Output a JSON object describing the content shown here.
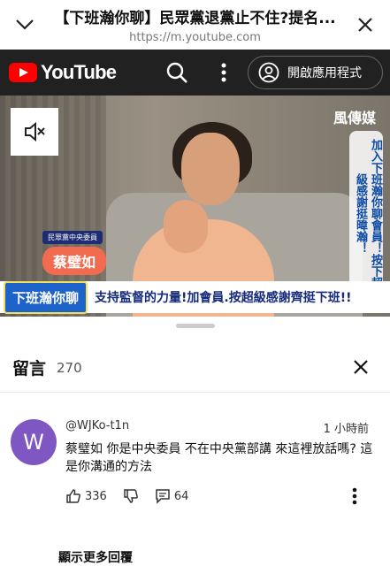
{
  "browser": {
    "page_title": "【下班瀚你聊】民眾黨退黨止不住?提名...",
    "url": "https://m.youtube.com"
  },
  "youtube": {
    "logo_text": "YouTube",
    "open_app_label": "開啟應用程式"
  },
  "video": {
    "watermark": "風傳媒",
    "side_promo": "加入下班瀚你聊會員！按下超級感謝挺暐瀚！",
    "name_role": "民眾黨中央委員",
    "name": "蔡璧如",
    "show_badge": "下班瀚你聊",
    "banner_text": "支持監督的力量!加會員.按超級感謝齊挺下班!!"
  },
  "comments": {
    "title": "留言",
    "count": "270",
    "items": [
      {
        "avatar_letter": "W",
        "author": "@WJKo-t1n",
        "time": "1 小時前",
        "text": "蔡璧如 你是中央委員 不在中央黨部講 來這裡放話嗎? 這是你溝通的方法",
        "likes": "336",
        "replies": "64"
      }
    ],
    "show_more_replies": "顯示更多回覆"
  },
  "colors": {
    "yt_red": "#ff0000",
    "yt_dark": "#212121",
    "avatar": "#7e57c2"
  },
  "icons": [
    "chevron-down-icon",
    "close-icon",
    "search-icon",
    "more-vert-icon",
    "account-icon",
    "mute-icon",
    "thumb-up-icon",
    "thumb-down-icon",
    "comment-icon"
  ]
}
